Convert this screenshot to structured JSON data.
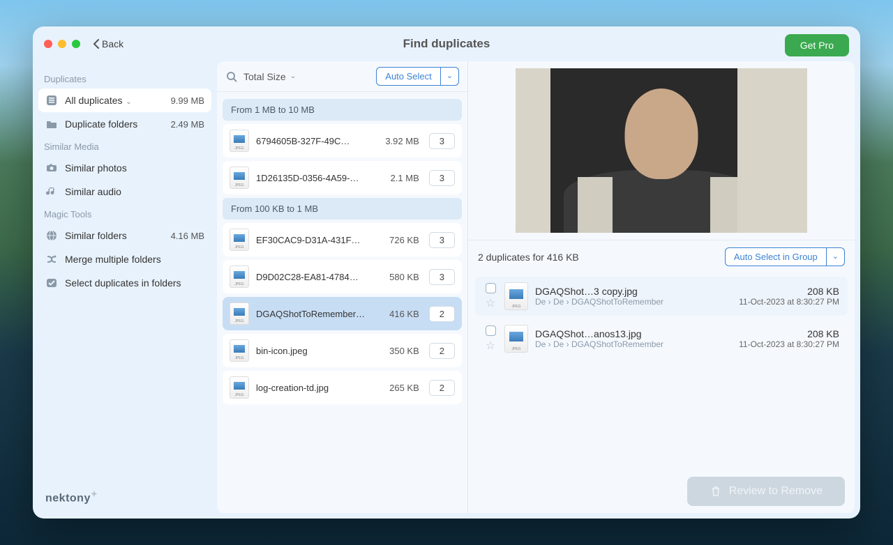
{
  "window": {
    "title": "Find duplicates",
    "back": "Back",
    "get_pro": "Get Pro"
  },
  "sidebar": {
    "sections": [
      {
        "label": "Duplicates",
        "items": [
          {
            "icon": "list-icon",
            "label": "All duplicates",
            "size": "9.99 MB",
            "active": true,
            "chevron": true
          },
          {
            "icon": "folder-icon",
            "label": "Duplicate folders",
            "size": "2.49 MB"
          }
        ]
      },
      {
        "label": "Similar Media",
        "items": [
          {
            "icon": "camera-icon",
            "label": "Similar photos"
          },
          {
            "icon": "music-icon",
            "label": "Similar audio"
          }
        ]
      },
      {
        "label": "Magic Tools",
        "items": [
          {
            "icon": "globe-icon",
            "label": "Similar folders",
            "size": "4.16 MB"
          },
          {
            "icon": "merge-icon",
            "label": "Merge multiple folders"
          },
          {
            "icon": "check-folder-icon",
            "label": "Select duplicates in folders"
          }
        ]
      }
    ]
  },
  "list": {
    "sort_label": "Total Size",
    "auto_select": "Auto Select",
    "groups": [
      {
        "header": "From 1 MB to 10 MB",
        "rows": [
          {
            "name": "6794605B-327F-49C…",
            "size": "3.92 MB",
            "count": "3"
          },
          {
            "name": "1D26135D-0356-4A59-…",
            "size": "2.1 MB",
            "count": "3"
          }
        ]
      },
      {
        "header": "From 100 KB to 1 MB",
        "rows": [
          {
            "name": "EF30CAC9-D31A-431F…",
            "size": "726 KB",
            "count": "3"
          },
          {
            "name": "D9D02C28-EA81-4784…",
            "size": "580 KB",
            "count": "3"
          },
          {
            "name": "DGAQShotToRemember…",
            "size": "416 KB",
            "count": "2",
            "selected": true
          },
          {
            "name": "bin-icon.jpeg",
            "size": "350 KB",
            "count": "2"
          },
          {
            "name": "log-creation-td.jpg",
            "size": "265 KB",
            "count": "2"
          }
        ]
      }
    ]
  },
  "detail": {
    "summary": "2 duplicates for 416 KB",
    "auto_select_group": "Auto Select in Group",
    "items": [
      {
        "name": "DGAQShot…3 copy.jpg",
        "path": "De  ›  De  ›  DGAQShotToRemember",
        "size": "208 KB",
        "date": "11-Oct-2023 at 8:30:27 PM",
        "highlight": true
      },
      {
        "name": "DGAQShot…anos13.jpg",
        "path": "De  ›  De  ›  DGAQShotToRemember",
        "size": "208 KB",
        "date": "11-Oct-2023 at 8:30:27 PM"
      }
    ]
  },
  "bottom": {
    "review": "Review to Remove"
  },
  "footer": {
    "logo": "nektony"
  }
}
